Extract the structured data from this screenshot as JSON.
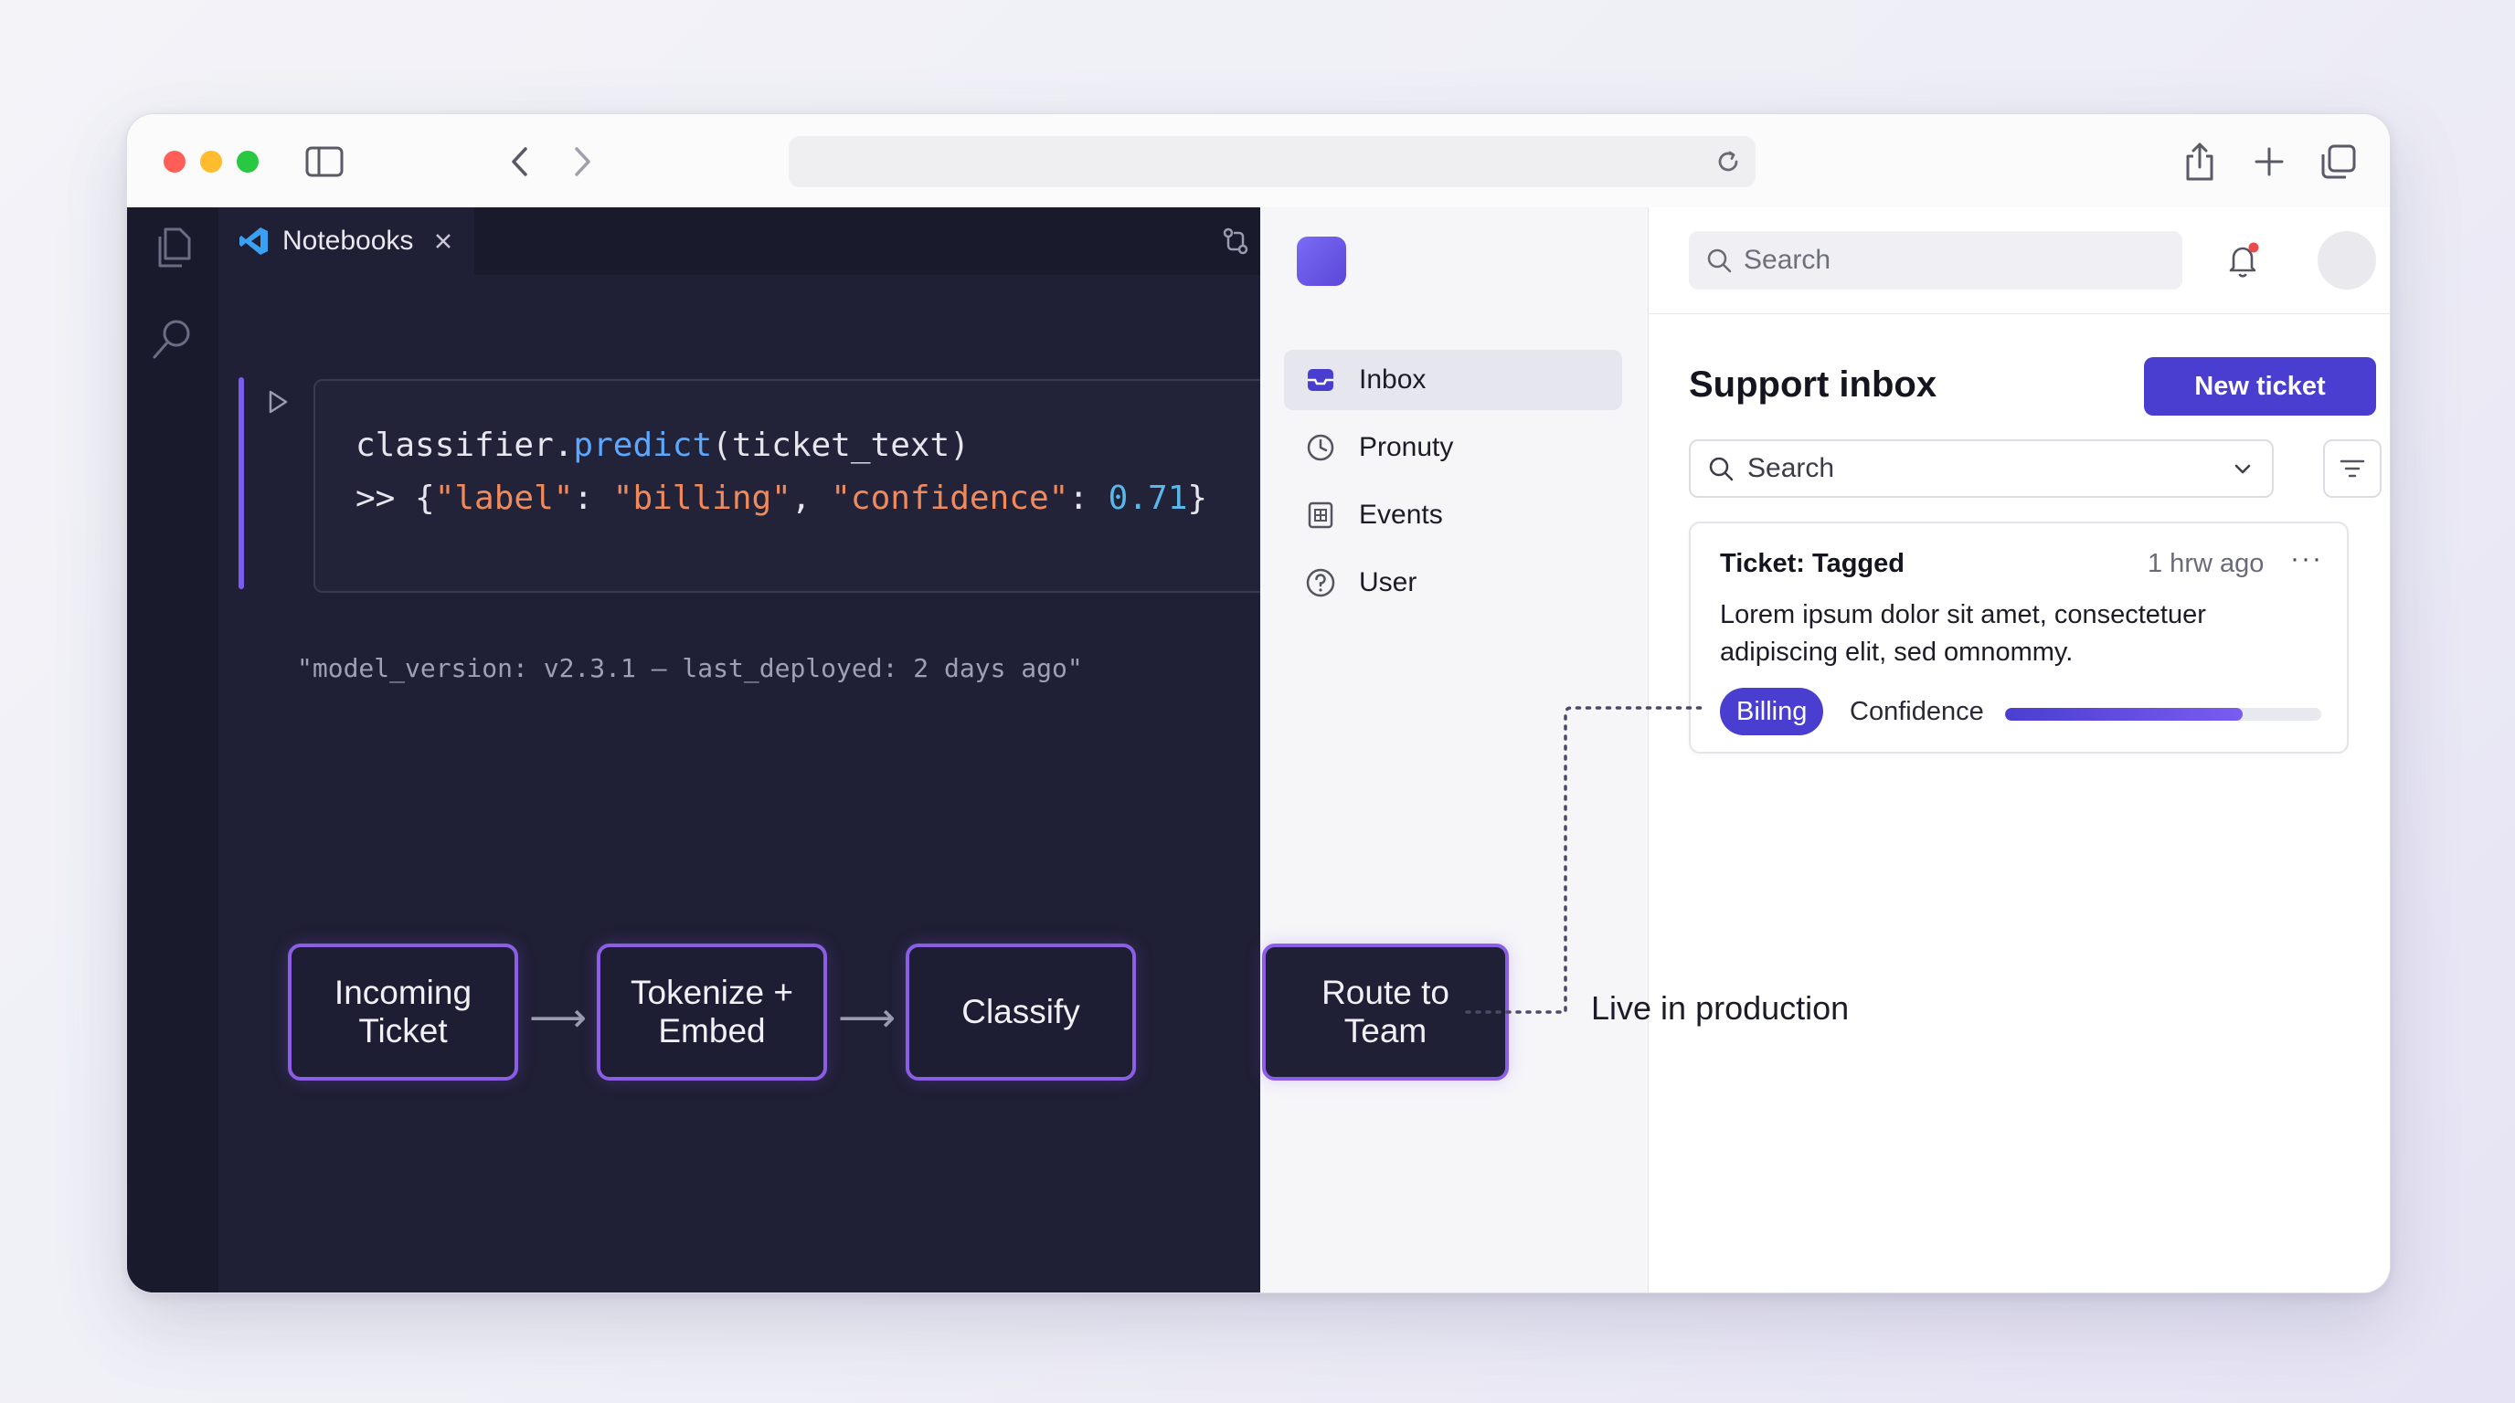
{
  "editor": {
    "tab_label": "Notebooks",
    "code_line_1": [
      {
        "t": "classifier.",
        "c": "#e6e6ee"
      },
      {
        "t": "predict",
        "c": "#5aa8ff"
      },
      {
        "t": "(ticket_text)",
        "c": "#e6e6ee"
      }
    ],
    "code_line_2": [
      {
        "t": ">> {",
        "c": "#e6e6ee"
      },
      {
        "t": "\"label\"",
        "c": "#f08a5d"
      },
      {
        "t": ": ",
        "c": "#e6e6ee"
      },
      {
        "t": "\"billing\"",
        "c": "#f08a5d"
      },
      {
        "t": ", ",
        "c": "#e6e6ee"
      },
      {
        "t": "\"confidence\"",
        "c": "#f08a5d"
      },
      {
        "t": ": ",
        "c": "#e6e6ee"
      },
      {
        "t": "0.71",
        "c": "#5ab8e8"
      },
      {
        "t": "}",
        "c": "#e6e6ee"
      }
    ],
    "meta_line": "\"model_version: v2.3.1 — last_deployed: 2 days ago\""
  },
  "flow": {
    "steps": [
      "Incoming\nTicket",
      "Tokenize +\nEmbed",
      "Classify",
      "Route to\nTeam"
    ],
    "callout": "Live in production"
  },
  "app": {
    "nav": [
      {
        "label": "Inbox",
        "icon": "inbox-icon",
        "active": true
      },
      {
        "label": "Pronuty",
        "icon": "clock-icon",
        "active": false
      },
      {
        "label": "Events",
        "icon": "calendar-icon",
        "active": false
      },
      {
        "label": "User",
        "icon": "help-circle-icon",
        "active": false
      }
    ],
    "top_search_placeholder": "Search",
    "page_title": "Support inbox",
    "new_ticket_label": "New ticket",
    "filter_search_placeholder": "Search",
    "ticket": {
      "title": "Ticket: Tagged",
      "time": "1 hrw ago",
      "more": "···",
      "body": "Lorem ipsum dolor sit amet, consectetuer adipiscing elit, sed omnommy.",
      "badge": "Billing",
      "confidence_label": "Confidence",
      "confidence_value": 0.75
    }
  },
  "colors": {
    "accent": "#4a3ed0",
    "flow_border": "#8c5ee6",
    "editor_bg": "#1f1f35"
  }
}
